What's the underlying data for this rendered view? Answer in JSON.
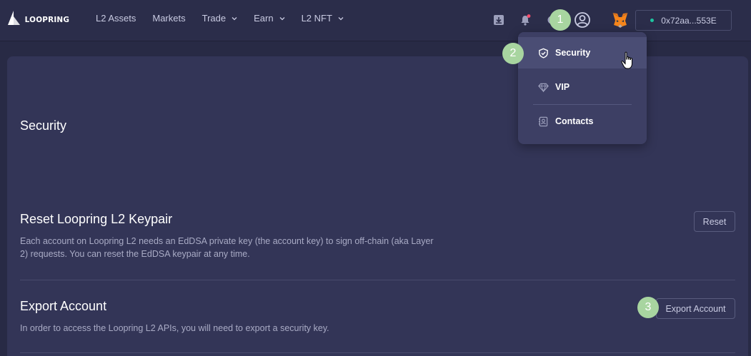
{
  "app": {
    "logo_text": "LOOPRING"
  },
  "header": {
    "nav": [
      {
        "label": "L2 Assets",
        "has_dropdown": false
      },
      {
        "label": "Markets",
        "has_dropdown": false
      },
      {
        "label": "Trade",
        "has_dropdown": true
      },
      {
        "label": "Earn",
        "has_dropdown": true
      },
      {
        "label": "L2 NFT",
        "has_dropdown": true
      }
    ],
    "icons": [
      "download-icon",
      "bell-icon",
      "gear-icon",
      "account-icon",
      "metamask-fox-icon"
    ],
    "wallet_address": "0x72aa...553E",
    "wallet_status_color": "#1ec5a0"
  },
  "dropdown": {
    "items": [
      {
        "label": "Security",
        "icon": "shield-icon",
        "active": true
      },
      {
        "label": "VIP",
        "icon": "diamond-icon",
        "active": false
      },
      {
        "label": "Contacts",
        "icon": "contacts-icon",
        "active": false
      }
    ]
  },
  "main": {
    "page_title": "Security",
    "reset": {
      "title": "Reset Loopring L2 Keypair",
      "description": "Each account on Loopring L2 needs an EdDSA private key (the account key) to sign off-chain (aka Layer 2) requests. You can reset the EdDSA keypair at any time.",
      "button_label": "Reset"
    },
    "export": {
      "title": "Export Account",
      "description": "In order to access the Loopring L2 APIs, you will need to export a security key.",
      "button_label": "Export Account"
    }
  },
  "annotations": {
    "steps": [
      "1",
      "2",
      "3"
    ],
    "badge_color": "#a8d5a0"
  }
}
